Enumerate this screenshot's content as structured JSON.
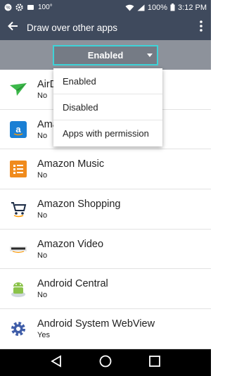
{
  "status_bar": {
    "temperature": "100°",
    "battery": "100%",
    "time": "3:12 PM",
    "icons": [
      "percent-icon",
      "settings-icon",
      "weather-icon",
      "wifi-icon",
      "signal-icon",
      "battery-icon"
    ]
  },
  "app_bar": {
    "title": "Draw over other apps",
    "icons": [
      "back-arrow-icon",
      "overflow-menu-icon"
    ]
  },
  "filter": {
    "selected": "Enabled",
    "options": [
      "Enabled",
      "Disabled",
      "Apps with permission"
    ]
  },
  "apps": [
    {
      "name": "AirDroid",
      "status": "No",
      "icon": "airdroid-icon"
    },
    {
      "name": "Amazon",
      "status": "No",
      "icon": "amazon-icon"
    },
    {
      "name": "Amazon Music",
      "status": "No",
      "icon": "amazon-music-icon"
    },
    {
      "name": "Amazon Shopping",
      "status": "No",
      "icon": "amazon-shopping-icon"
    },
    {
      "name": "Amazon Video",
      "status": "No",
      "icon": "amazon-video-icon"
    },
    {
      "name": "Android Central",
      "status": "No",
      "icon": "android-central-icon"
    },
    {
      "name": "Android System WebView",
      "status": "Yes",
      "icon": "android-webview-icon"
    }
  ],
  "nav_bar": {
    "icons": [
      "back-triangle-icon",
      "home-circle-icon",
      "recents-square-icon"
    ]
  },
  "colors": {
    "toolbar": "#3f4a5d",
    "filter_bar": "#8d929b",
    "dropdown_border": "#3ed3d8"
  }
}
